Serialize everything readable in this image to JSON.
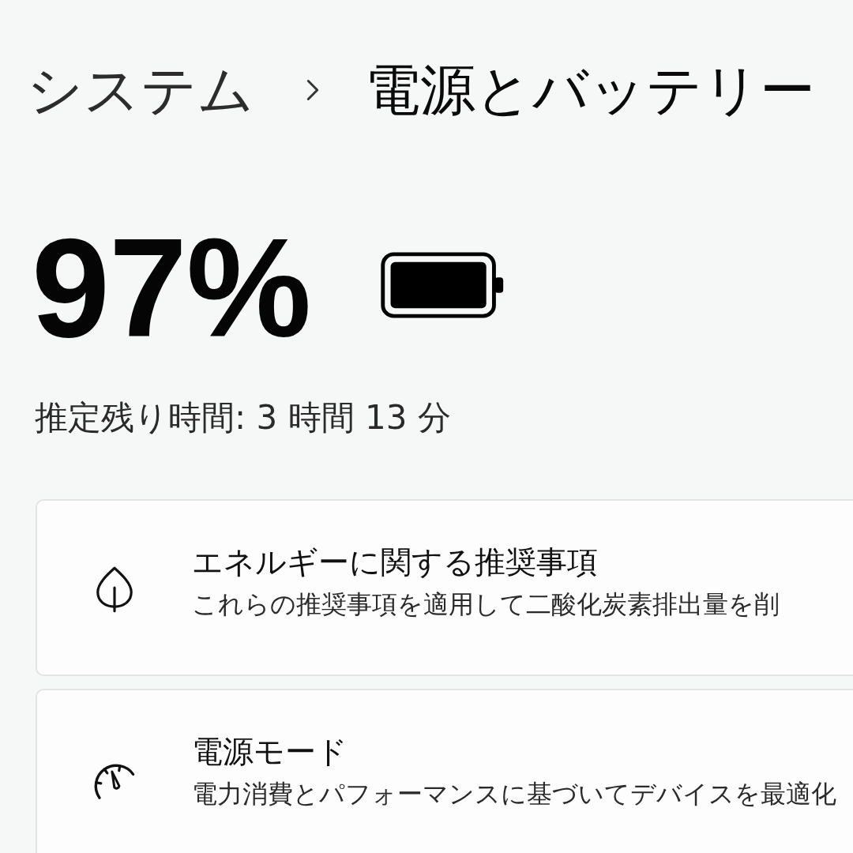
{
  "breadcrumb": {
    "parent": "システム",
    "current": "電源とバッテリー"
  },
  "battery": {
    "percent": "97%",
    "estimate": "推定残り時間: 3 時間 13 分"
  },
  "settings": [
    {
      "title": "エネルギーに関する推奨事項",
      "description": "これらの推奨事項を適用して二酸化炭素排出量を削"
    },
    {
      "title": "電源モード",
      "description": "電力消費とパフォーマンスに基づいてデバイスを最適化"
    }
  ]
}
